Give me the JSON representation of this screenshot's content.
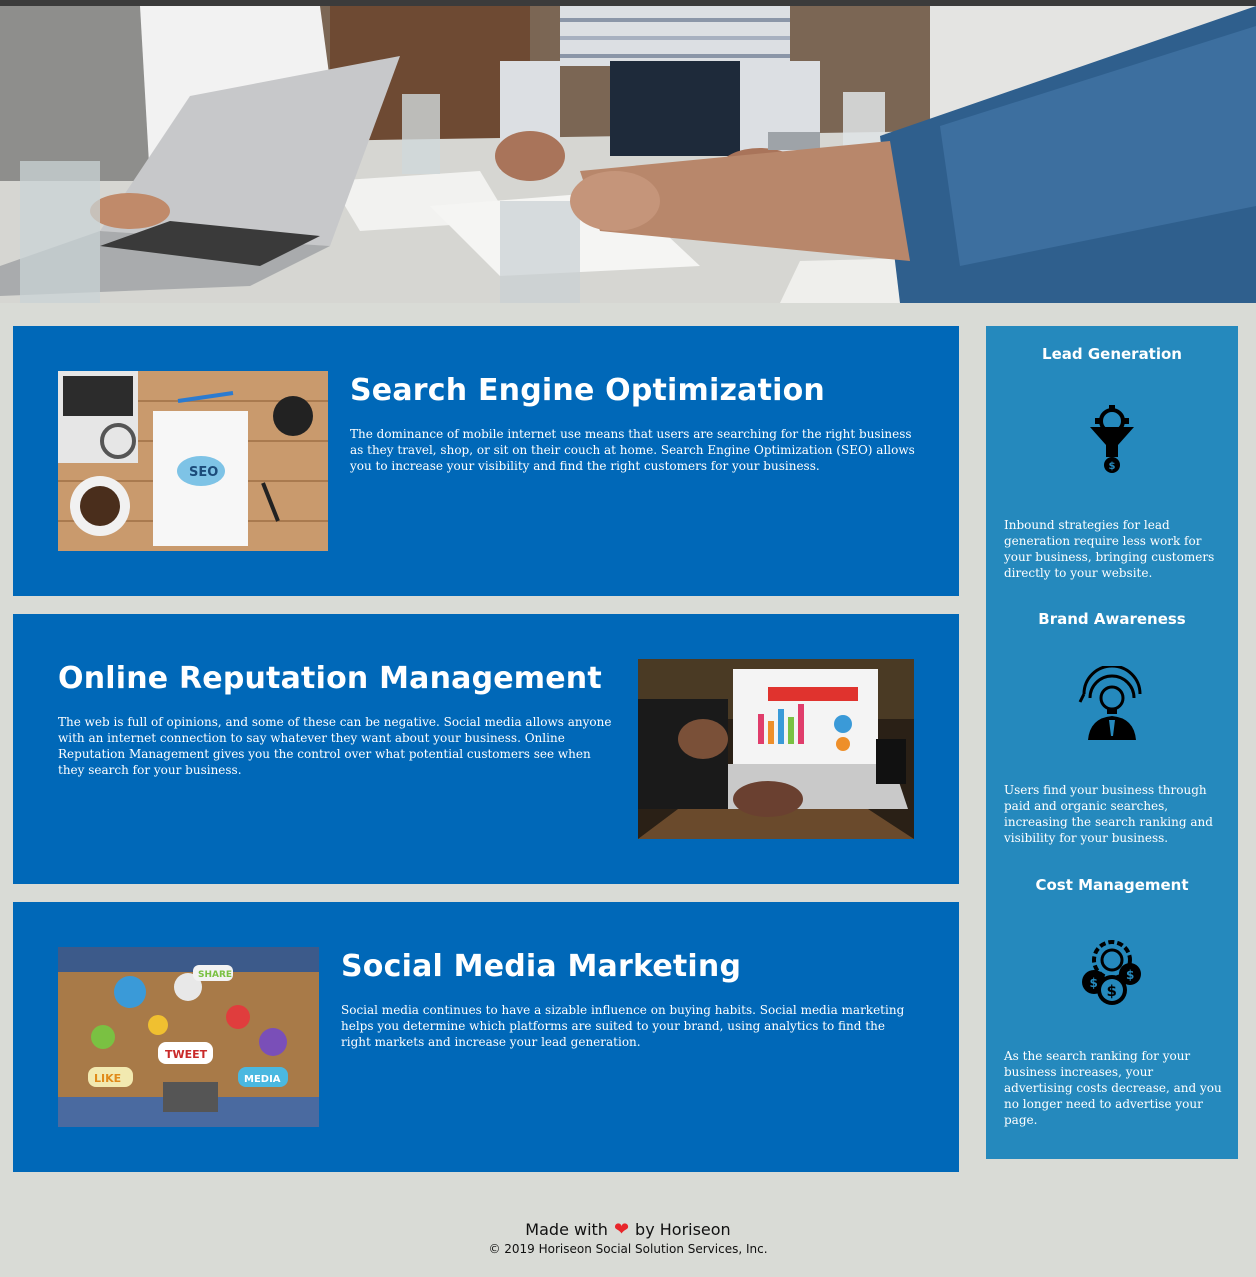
{
  "hero": {
    "image": "team-meeting-photo"
  },
  "services": [
    {
      "title": "Search Engine Optimization",
      "body": "The dominance of mobile internet use means that users are searching for the right business as they travel, shop, or sit on their couch at home. Search Engine Optimization (SEO) allows you to increase your visibility and find the right customers for your business.",
      "image": "seo-notebook-photo"
    },
    {
      "title": "Online Reputation Management",
      "body": "The web is full of opinions, and some of these can be negative. Social media allows anyone with an internet connection to say whatever they want about your business. Online Reputation Management gives you the control over what potential customers see when they search for your business.",
      "image": "reputation-laptop-photo"
    },
    {
      "title": "Social Media Marketing",
      "body": "Social media continues to have a sizable influence on buying habits. Social media marketing helps you determine which platforms are suited to your brand, using analytics to find the right markets and increase your lead generation.",
      "image": "social-media-table-photo"
    }
  ],
  "benefits": [
    {
      "title": "Lead Generation",
      "icon": "funnel-gear-dollar-icon",
      "body": "Inbound strategies for lead generation require less work for your business, bringing customers directly to your website."
    },
    {
      "title": "Brand Awareness",
      "icon": "lightbulb-person-icon",
      "body": "Users find your business through paid and organic searches, increasing the search ranking and visibility for your business."
    },
    {
      "title": "Cost Management",
      "icon": "gear-coins-icon",
      "body": "As the search ranking for your business increases, your advertising costs decrease, and you no longer need to advertise your page."
    }
  ],
  "footer": {
    "made_with": "Made with",
    "heart": "❤",
    "by": "by Horiseon",
    "copyright": "© 2019 Horiseon Social Solution Services, Inc."
  },
  "colors": {
    "card_blue": "#0068b8",
    "sidebar_blue": "#2589bd",
    "page_bg": "#d9dbd6",
    "heart": "#e8262b"
  }
}
